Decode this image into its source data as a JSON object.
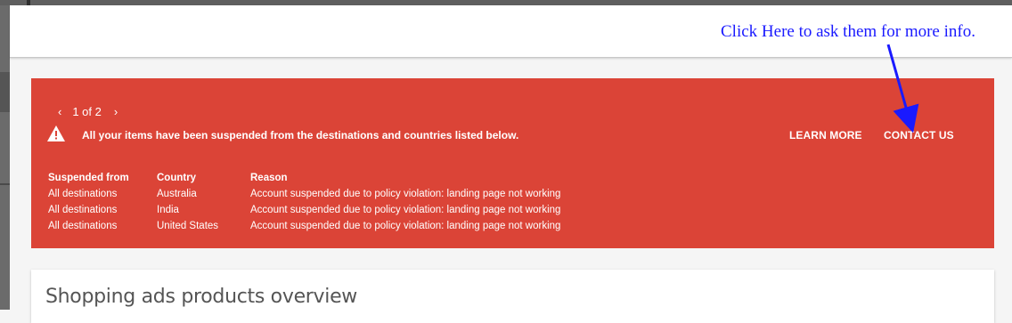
{
  "annotation": {
    "text": "Click Here to ask them for more info.",
    "color": "#1a1aff"
  },
  "alert": {
    "background": "#db4437",
    "pager": {
      "prev_icon": "chevron-left-icon",
      "next_icon": "chevron-right-icon",
      "prev": "‹",
      "next": "›",
      "count": "1 of 2"
    },
    "warning_icon": "warning-triangle-icon",
    "message": "All your items have been suspended from the destinations and countries listed below.",
    "learn_more": "LEARN MORE",
    "contact_us": "CONTACT US"
  },
  "table": {
    "headers": [
      "Suspended from",
      "Country",
      "Reason"
    ],
    "rows": [
      [
        "All destinations",
        "Australia",
        "Account suspended due to policy violation: landing page not working"
      ],
      [
        "All destinations",
        "India",
        "Account suspended due to policy violation: landing page not working"
      ],
      [
        "All destinations",
        "United States",
        "Account suspended due to policy violation: landing page not working"
      ]
    ]
  },
  "card": {
    "title": "Shopping ads products overview"
  }
}
